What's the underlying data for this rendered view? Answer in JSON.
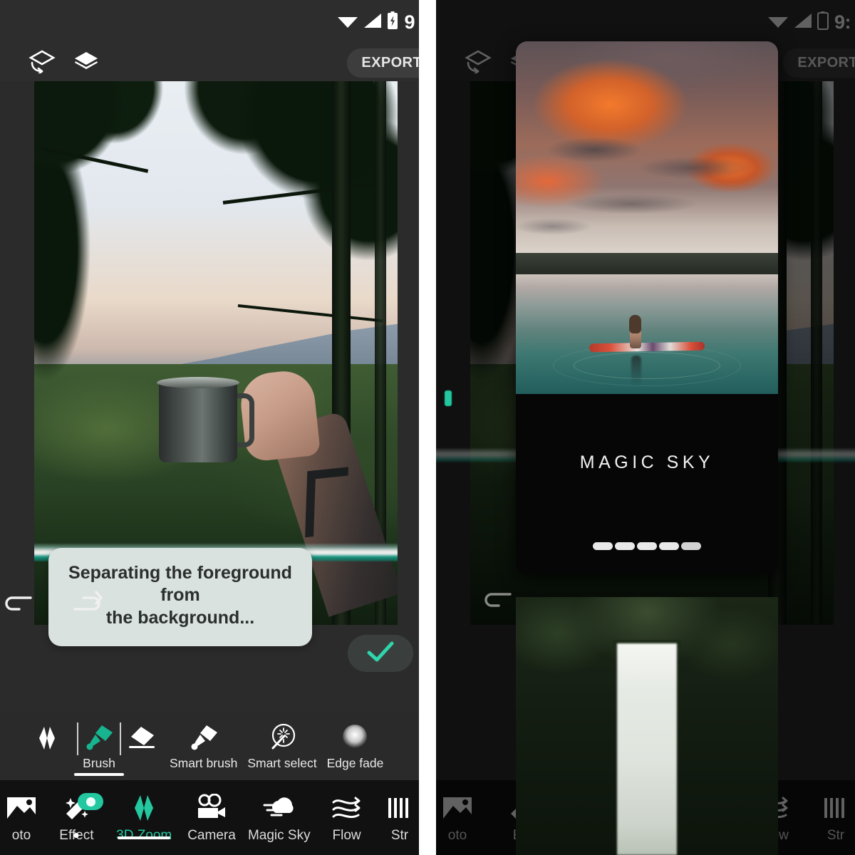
{
  "app": {
    "accent_color": "#23c8a0",
    "panel_bg": "#2b2b2b",
    "nav_bg": "#111111"
  },
  "left_panel": {
    "status_bar": {
      "wifi_icon": "wifi-icon",
      "signal_icon": "cellular-signal-icon",
      "battery_icon": "battery-charging-icon",
      "battery_text": "9"
    },
    "top_toolbar": {
      "layers_outline_icon": "layers-outline-icon",
      "layers_filled_icon": "layers-filled-icon",
      "export_label": "EXPORT"
    },
    "toast": {
      "line1": "Separating the foreground from",
      "line2": "the background..."
    },
    "actions": {
      "undo_icon": "undo-arrow-icon",
      "redo_icon": "redo-arrow-icon",
      "confirm_icon": "checkmark-icon"
    },
    "tool_row": [
      {
        "label": "",
        "icon": "3d-zoom-diamond-icon",
        "active": false
      },
      {
        "label": "Brush",
        "icon": "brush-icon",
        "active": true
      },
      {
        "label": "",
        "icon": "eraser-icon",
        "active": false
      },
      {
        "label": "Smart brush",
        "icon": "smart-brush-icon",
        "active": false
      },
      {
        "label": "Smart select",
        "icon": "smart-select-icon",
        "active": false
      },
      {
        "label": "Edge fade",
        "icon": "edge-fade-icon",
        "active": false
      }
    ],
    "bottom_nav": [
      {
        "label": "oto",
        "icon": "photo-icon",
        "active": false,
        "badge": false
      },
      {
        "label": "Effect",
        "icon": "effect-wand-icon",
        "active": false,
        "badge": true
      },
      {
        "label": "3D Zoom",
        "icon": "3d-zoom-diamond-icon",
        "active": true,
        "badge": false
      },
      {
        "label": "Camera",
        "icon": "camera-icon",
        "active": false,
        "badge": false
      },
      {
        "label": "Magic Sky",
        "icon": "magic-sky-icon",
        "active": false,
        "badge": false
      },
      {
        "label": "Flow",
        "icon": "flow-icon",
        "active": false,
        "badge": false
      },
      {
        "label": "Str",
        "icon": "stripes-icon",
        "active": false,
        "badge": false
      }
    ]
  },
  "right_panel": {
    "status_bar": {
      "wifi_icon": "wifi-icon",
      "signal_icon": "cellular-signal-icon",
      "battery_icon": "battery-icon",
      "battery_text": "9:"
    },
    "top_toolbar": {
      "layers_outline_icon": "layers-outline-icon",
      "layers_filled_icon": "layers-filled-icon",
      "export_label": "EXPORT"
    },
    "tutorial_card": {
      "title": "MAGIC SKY",
      "progress_segments": 5,
      "progress_current": 5
    },
    "bottom_nav": [
      {
        "label": "oto",
        "icon": "photo-icon",
        "active": false
      },
      {
        "label": "Eff",
        "icon": "effect-wand-icon",
        "active": false
      },
      {
        "label": "Flow",
        "icon": "flow-icon",
        "active": false
      },
      {
        "label": "Str",
        "icon": "stripes-icon",
        "active": false
      }
    ]
  }
}
